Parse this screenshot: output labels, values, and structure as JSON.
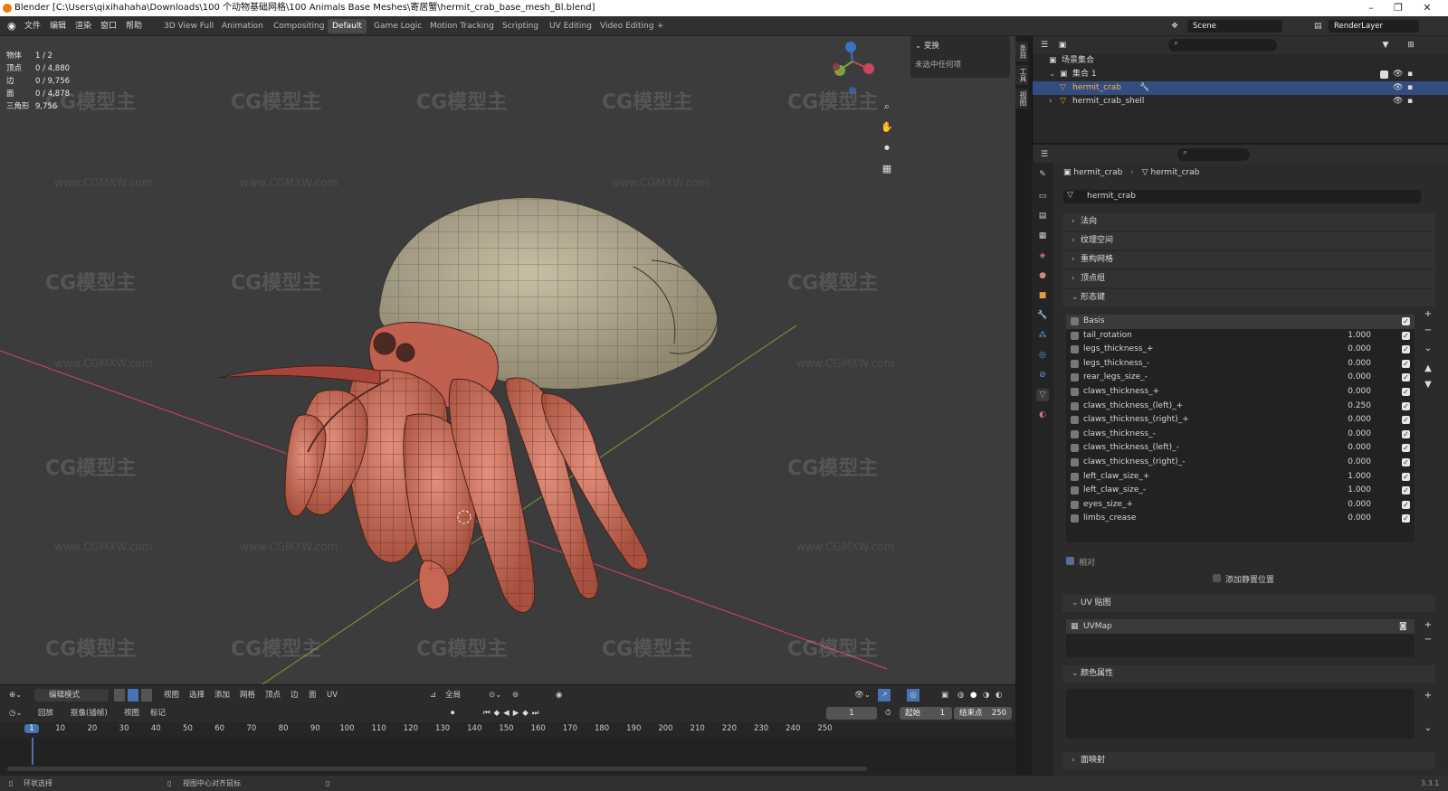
{
  "window": {
    "title": "Blender [C:\\Users\\qixihahaha\\Downloads\\100 个动物基础网格\\100 Animals Base Meshes\\寄居蟹\\hermit_crab_base_mesh_Bl.blend]",
    "minimize": "–",
    "maximize": "❐",
    "close": "✕"
  },
  "menu": {
    "file": "文件",
    "edit": "编辑",
    "render": "渲染",
    "window": "窗口",
    "help": "帮助"
  },
  "workspaces": [
    "3D View Full",
    "Animation",
    "Compositing",
    "Default",
    "Game Logic",
    "Motion Tracking",
    "Scripting",
    "UV Editing",
    "Video Editing"
  ],
  "workspace_add": "+",
  "active_workspace": "Default",
  "scene": {
    "name": "Scene",
    "render_layer": "RenderLayer"
  },
  "stats": [
    {
      "label": "物体",
      "value": "1 / 2"
    },
    {
      "label": "顶点",
      "value": "0 / 4,880"
    },
    {
      "label": "边",
      "value": "0 / 9,756"
    },
    {
      "label": "面",
      "value": "0 / 4,878"
    },
    {
      "label": "三角形",
      "value": "9,756"
    }
  ],
  "npanel": {
    "header": "变换",
    "empty": "未选中任何项"
  },
  "side_tabs": [
    "条目",
    "工具",
    "视图"
  ],
  "outliner": {
    "root": "场景集合",
    "collection": "集合 1",
    "objects": [
      "hermit_crab",
      "hermit_crab_shell"
    ]
  },
  "properties": {
    "breadcrumb_obj": "hermit_crab",
    "breadcrumb_data": "hermit_crab",
    "mesh_name": "hermit_crab",
    "sections": [
      "法向",
      "纹理空间",
      "重构网格",
      "顶点组",
      "形态键"
    ],
    "shape_keys": [
      {
        "name": "Basis",
        "value": ""
      },
      {
        "name": "tail_rotation",
        "value": "1.000"
      },
      {
        "name": "legs_thickness_+",
        "value": "0.000"
      },
      {
        "name": "legs_thickness_-",
        "value": "0.000"
      },
      {
        "name": "rear_legs_size_-",
        "value": "0.000"
      },
      {
        "name": "claws_thickness_+",
        "value": "0.000"
      },
      {
        "name": "claws_thickness_(left)_+",
        "value": "0.250"
      },
      {
        "name": "claws_thickness_(right)_+",
        "value": "0.000"
      },
      {
        "name": "claws_thickness_-",
        "value": "0.000"
      },
      {
        "name": "claws_thickness_(left)_-",
        "value": "0.000"
      },
      {
        "name": "claws_thickness_(right)_-",
        "value": "0.000"
      },
      {
        "name": "left_claw_size_+",
        "value": "1.000"
      },
      {
        "name": "left_claw_size_-",
        "value": "1.000"
      },
      {
        "name": "eyes_size_+",
        "value": "0.000"
      },
      {
        "name": "limbs_crease",
        "value": "0.000"
      }
    ],
    "relative": "相对",
    "add_rest": "添加静置位置",
    "uv_section": "UV 贴图",
    "uv_map": "UVMap",
    "color_section": "颜色属性",
    "face_maps": "面映射",
    "checkmark": "✓"
  },
  "viewport_header": {
    "mode": "编辑模式",
    "view": "视图",
    "select": "选择",
    "add": "添加",
    "mesh": "网格",
    "vertex": "顶点",
    "edge": "边",
    "face": "面",
    "uv": "UV",
    "orientation": "全局"
  },
  "timeline": {
    "playback": "回放",
    "keying": "抠像(插帧)",
    "view": "视图",
    "marker": "标记",
    "current_frame": "1",
    "start_label": "起始",
    "start": "1",
    "end_label": "结束点",
    "end": "250",
    "ticks": [
      1,
      10,
      20,
      30,
      40,
      50,
      60,
      70,
      80,
      90,
      100,
      110,
      120,
      130,
      140,
      150,
      160,
      170,
      180,
      190,
      200,
      210,
      220,
      230,
      240,
      250
    ]
  },
  "status": {
    "left": "环状选择",
    "mid": "视图中心对齐鼠标",
    "version": "3.3.1"
  },
  "watermark": {
    "logo": "CG模型主",
    "url": "www.CGMXW.com"
  },
  "colors": {
    "accent": "#4772b3",
    "shell": "#b6ae95",
    "body": "#d27462",
    "x_axis": "#c9485a",
    "y_axis": "#7da33a",
    "z_axis": "#3c72c4"
  }
}
